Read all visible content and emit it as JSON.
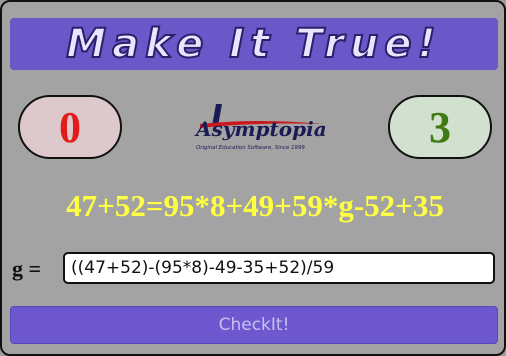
{
  "title": "Make It True!",
  "scores": {
    "wrong": "0",
    "right": "3"
  },
  "logo": {
    "name": "Asymptopia",
    "tagline": "Original Education Software, Since 1999"
  },
  "equation": "47+52=95*8+49+59*g-52+35",
  "answer": {
    "label": "g =",
    "value": "((47+52)-(95*8)-49-35+52)/59"
  },
  "check_button": "CheckIt!",
  "colors": {
    "background": "#a3a3a3",
    "title_bar": "#6a57c8",
    "equation": "#ffff44",
    "wrong_score": "#e21b1b",
    "right_score": "#3f7a12",
    "button": "#6e58d0"
  }
}
